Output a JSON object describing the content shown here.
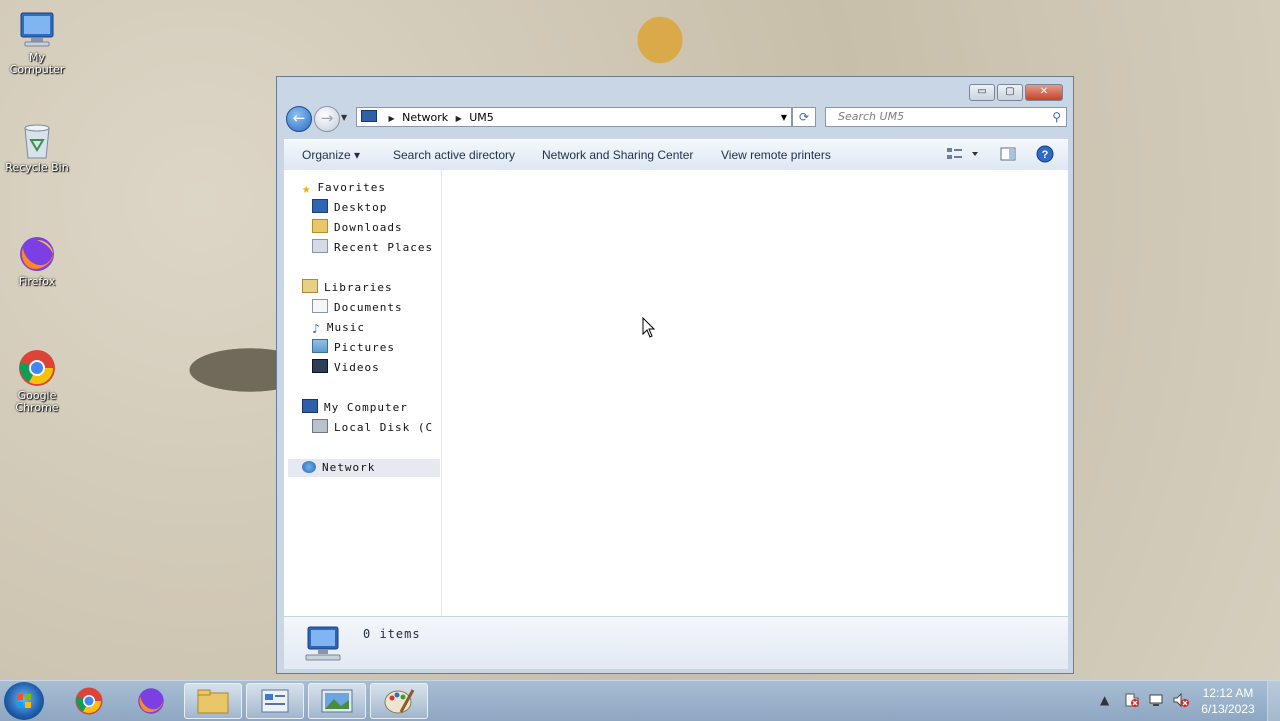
{
  "desktop": {
    "icons": [
      {
        "label": "My Computer"
      },
      {
        "label": "Recycle Bin"
      },
      {
        "label": "Firefox"
      },
      {
        "label": "Google Chrome"
      }
    ]
  },
  "window": {
    "caption_buttons": {
      "minimize": "▭",
      "maximize": "▢",
      "close": "✕"
    },
    "address": {
      "segments": [
        "Network",
        "UM5"
      ]
    },
    "search": {
      "placeholder": "Search UM5"
    },
    "toolbar": {
      "organize": "Organize ▾",
      "search_ad": "Search active directory",
      "network_sharing": "Network and Sharing Center",
      "view_printers": "View remote printers"
    },
    "nav": {
      "favorites": "Favorites",
      "desktop": "Desktop",
      "downloads": "Downloads",
      "recent": "Recent Places",
      "libraries": "Libraries",
      "documents": "Documents",
      "music": "Music",
      "pictures": "Pictures",
      "videos": "Videos",
      "computer": "My Computer",
      "local_disk": "Local Disk (C",
      "network": "Network"
    },
    "details": {
      "count": "0 items"
    }
  },
  "taskbar": {
    "clock_time": "12:12 AM",
    "clock_date": "6/13/2023",
    "tray_arrow": "▲"
  }
}
